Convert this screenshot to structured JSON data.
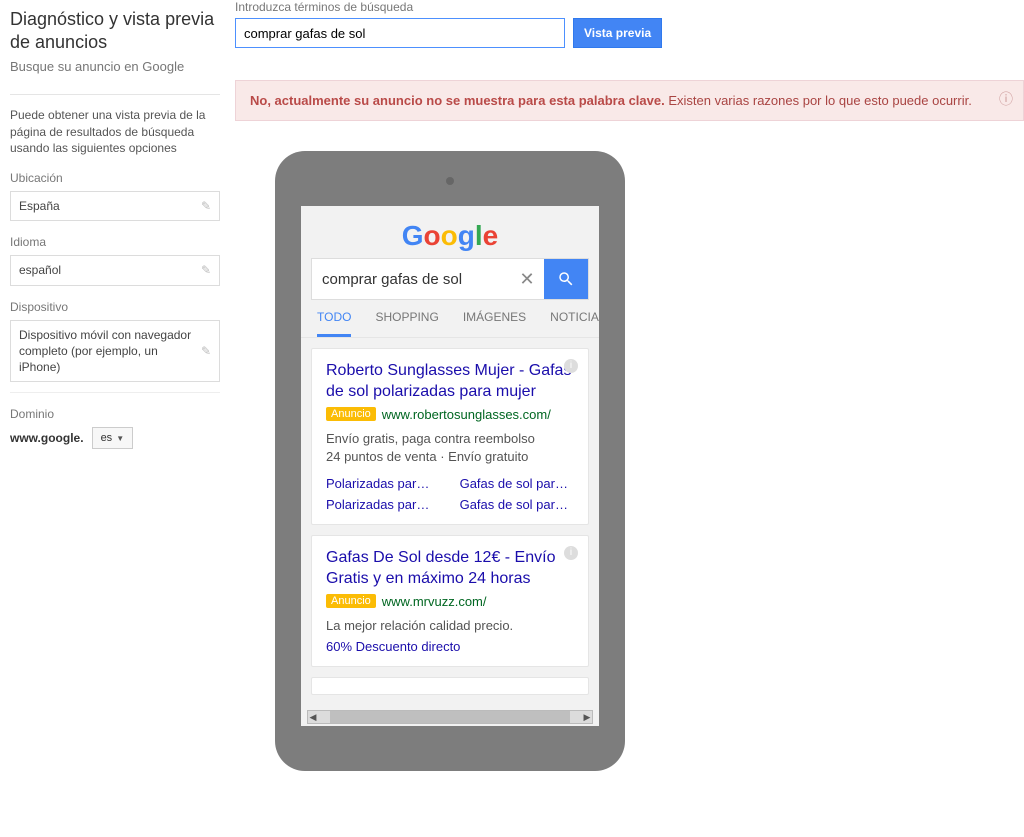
{
  "header": {
    "title": "Diagnóstico y vista previa de anuncios",
    "subtitle": "Busque su anuncio en Google"
  },
  "sidebar": {
    "instruction": "Puede obtener una vista previa de la página de resultados de búsqueda usando las siguientes opciones",
    "location_label": "Ubicación",
    "location_value": "España",
    "language_label": "Idioma",
    "language_value": "español",
    "device_label": "Dispositivo",
    "device_value": "Dispositivo móvil con navegador completo (por ejemplo, un iPhone)",
    "domain_label": "Dominio",
    "domain_value": "www.google.",
    "domain_tld": "es"
  },
  "search": {
    "label": "Introduzca términos de búsqueda",
    "value": "comprar gafas de sol",
    "button": "Vista previa"
  },
  "alert": {
    "text_prefix": "No, actualmente su anuncio no se muestra para esta palabra clave.",
    "text_suffix": " Existen varias razones por lo que esto puede ocurrir."
  },
  "mobile": {
    "query": "comprar gafas de sol",
    "tabs": [
      "TODO",
      "SHOPPING",
      "IMÁGENES",
      "NOTICIAS"
    ],
    "ads": [
      {
        "title": "Roberto Sunglasses Mujer - Gafas de sol polarizadas para mujer",
        "badge": "Anuncio",
        "url": "www.robertosunglasses.com/",
        "desc1": "Envío gratis, paga contra reembolso",
        "desc2": "24 puntos de venta · Envío gratuito",
        "links": [
          "Polarizadas para …",
          "Gafas de sol para …",
          "Polarizadas para …",
          "Gafas de sol para …"
        ]
      },
      {
        "title": "Gafas De Sol desde 12€ - Envío Gratis y en máximo 24 horas",
        "badge": "Anuncio",
        "url": "www.mrvuzz.com/",
        "desc1": "La mejor relación calidad precio.",
        "promo": "60% Descuento directo"
      }
    ]
  }
}
